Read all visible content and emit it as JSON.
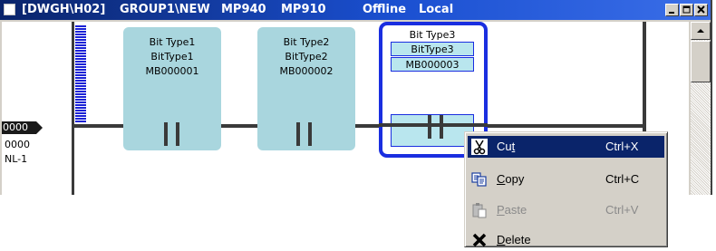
{
  "window": {
    "title_parts": [
      "[DWGH\\H02]",
      "GROUP1\\NEW",
      "MP940",
      "MP910",
      "Offline",
      "Local"
    ]
  },
  "ladder": {
    "left_tag": "0000",
    "left_line2": "0000",
    "left_line3": "NL-1",
    "blocks": [
      {
        "line1": "Bit Type1",
        "line2": "BitType1",
        "line3": "MB000001"
      },
      {
        "line1": "Bit Type2",
        "line2": "BitType2",
        "line3": "MB000002"
      },
      {
        "line1": "Bit Type3",
        "line2": "BitType3",
        "line3": "MB000003"
      }
    ]
  },
  "context_menu": {
    "items": [
      {
        "label_pre": "Cu",
        "label_mnemonic": "t",
        "label_post": "",
        "shortcut": "Ctrl+X",
        "icon": "scissors-icon",
        "state": "highlighted"
      },
      {
        "label_pre": "",
        "label_mnemonic": "C",
        "label_post": "opy",
        "shortcut": "Ctrl+C",
        "icon": "copy-icon",
        "state": "enabled"
      },
      {
        "label_pre": "",
        "label_mnemonic": "P",
        "label_post": "aste",
        "shortcut": "Ctrl+V",
        "icon": "paste-icon",
        "state": "disabled"
      },
      {
        "label_pre": "",
        "label_mnemonic": "D",
        "label_post": "elete",
        "shortcut": "",
        "icon": "delete-x-icon",
        "state": "enabled"
      }
    ]
  },
  "colors": {
    "titlebar": "#0a246a",
    "selection_border": "#1a2ee0",
    "block_fill": "#a9d6de",
    "menu_highlight": "#0a246a"
  }
}
